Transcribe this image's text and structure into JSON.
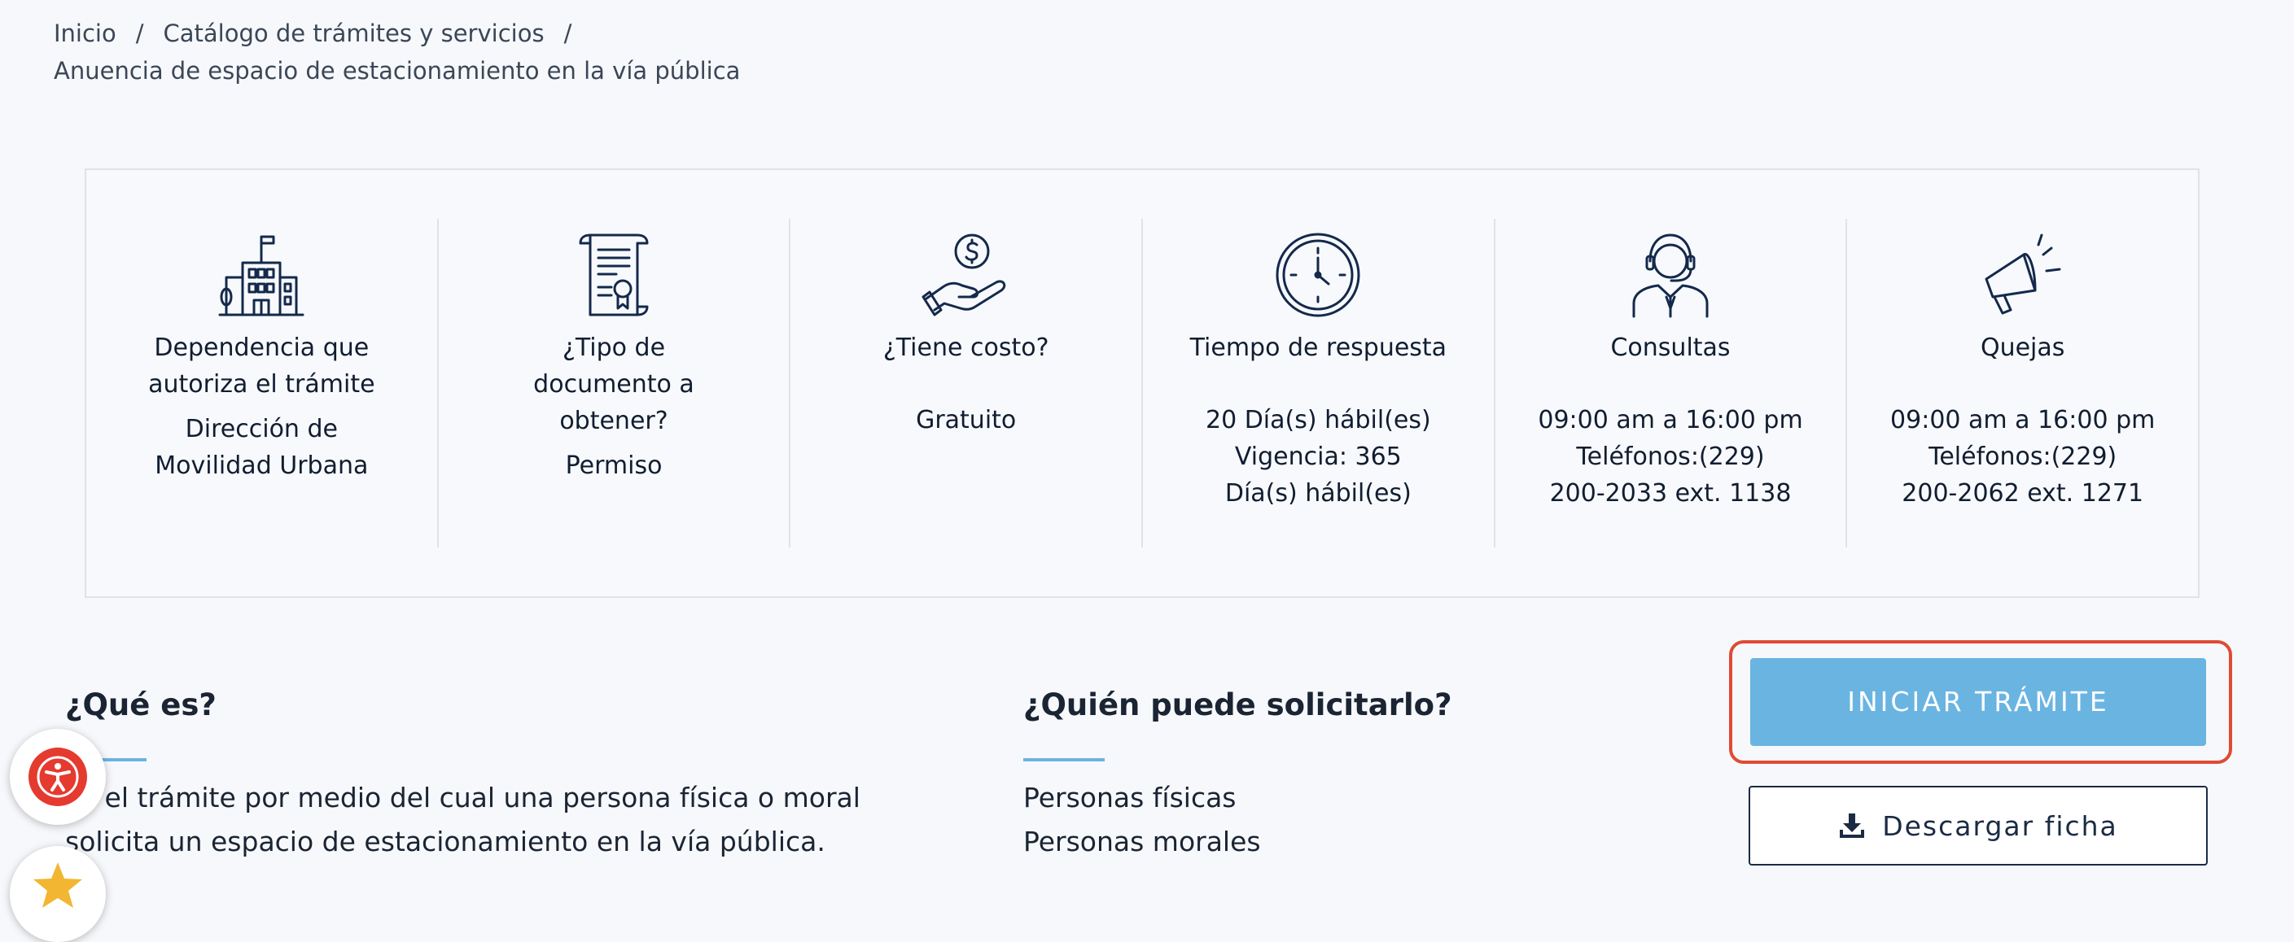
{
  "breadcrumb": {
    "home": "Inicio",
    "separator": "/",
    "catalog": "Catálogo de trámites y servicios",
    "current": "Anuencia de espacio de estacionamiento en la vía pública"
  },
  "info": {
    "dependencia": {
      "title": "Dependencia que autoriza el trámite",
      "value": "Dirección de Movilidad Urbana"
    },
    "documento": {
      "title": "¿Tipo de documento a obtener?",
      "value": "Permiso"
    },
    "costo": {
      "title": "¿Tiene costo?",
      "value": "Gratuito"
    },
    "tiempo": {
      "title": "Tiempo de respuesta",
      "line1": "20 Día(s) hábil(es)",
      "line2": "Vigencia: 365 Día(s) hábil(es)"
    },
    "consultas": {
      "title": "Consultas",
      "hours": "09:00 am a 16:00 pm",
      "phone": "Teléfonos:(229) 200-2033 ext. 1138"
    },
    "quejas": {
      "title": "Quejas",
      "hours": "09:00 am a 16:00 pm",
      "phone": "Teléfonos:(229) 200-2062 ext. 1271"
    }
  },
  "que_es": {
    "heading": "¿Qué es?",
    "text": "Es el trámite por medio del cual una persona física o moral solicita un espacio de estacionamiento en la vía pública."
  },
  "quien": {
    "heading": "¿Quién puede solicitarlo?",
    "items": [
      "Personas físicas",
      "Personas morales"
    ]
  },
  "actions": {
    "start": "INICIAR TRÁMITE",
    "download": "Descargar ficha"
  },
  "colors": {
    "primary_button": "#6ab4e2",
    "highlight": "#e04a35",
    "icon_stroke": "#14294b",
    "accent_rule": "#6bb3e3"
  }
}
